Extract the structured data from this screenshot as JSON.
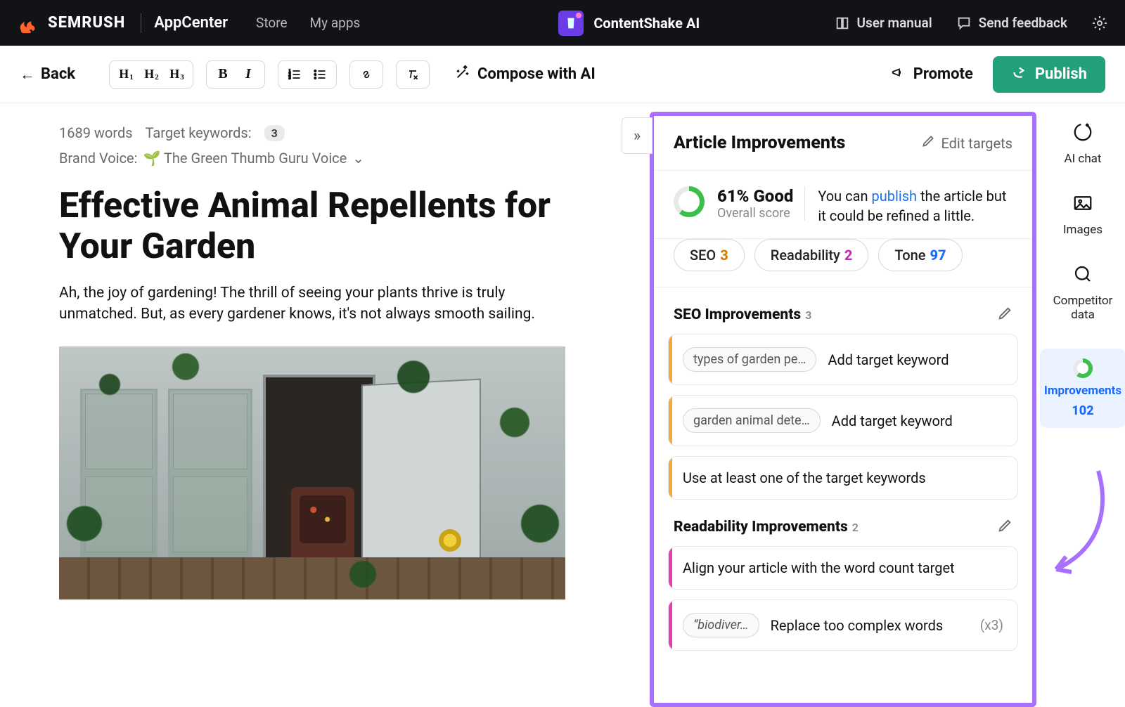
{
  "topbar": {
    "brand": "SEMRUSH",
    "subbrand": "AppCenter",
    "store": "Store",
    "myapps": "My apps",
    "appname": "ContentShake AI",
    "usermanual": "User manual",
    "feedback": "Send feedback"
  },
  "toolbar": {
    "back": "Back",
    "compose": "Compose with AI",
    "promote": "Promote",
    "publish": "Publish"
  },
  "editor": {
    "word_count": "1689 words",
    "target_kw_label": "Target keywords:",
    "target_kw_count": "3",
    "voice_label": "Brand Voice:",
    "voice_name": "🌱 The Green Thumb Guru Voice",
    "title": "Effective Animal Repellents for Your Garden",
    "intro": "Ah, the joy of gardening! The thrill of seeing your plants thrive is truly unmatched. But, as every gardener knows, it's not always smooth sailing."
  },
  "panel": {
    "title": "Article Improvements",
    "edit_targets": "Edit targets",
    "score_value": "61% Good",
    "score_sub": "Overall score",
    "score_msg_pre": "You can ",
    "score_msg_link": "publish",
    "score_msg_post": " the article but it could be refined a little.",
    "pills": {
      "seo_label": "SEO",
      "seo_n": "3",
      "read_label": "Readability",
      "read_n": "2",
      "tone_label": "Tone",
      "tone_n": "97"
    },
    "seo": {
      "head": "SEO Improvements",
      "count": "3",
      "cards": [
        {
          "chip": "types of garden pe…",
          "text": "Add target keyword"
        },
        {
          "chip": "garden animal dete…",
          "text": "Add target keyword"
        },
        {
          "text": "Use at least one of the target keywords"
        }
      ]
    },
    "read": {
      "head": "Readability Improvements",
      "count": "2",
      "cards": [
        {
          "text": "Align your article with the word count target"
        },
        {
          "chip": "“biodiver…",
          "text": "Replace too complex words",
          "mult": "(x3)"
        }
      ]
    }
  },
  "sidebar": {
    "aichat": "AI chat",
    "images": "Images",
    "competitor": "Competitor data",
    "improvements_label": "Improvements",
    "improvements_n": "102"
  }
}
